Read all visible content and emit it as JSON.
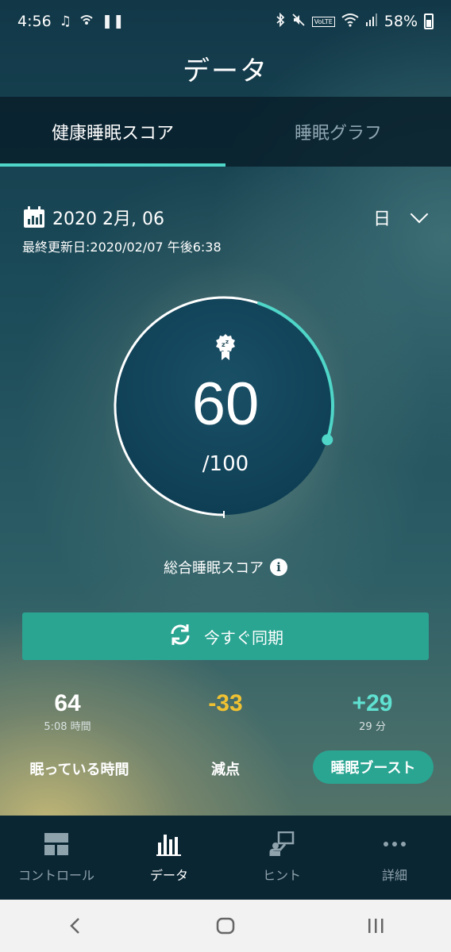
{
  "status_bar": {
    "time": "4:56",
    "battery": "58%",
    "left_icons": [
      "music-icon",
      "wifi-call-icon",
      "pause-icon"
    ],
    "right_icons": [
      "bluetooth-icon",
      "mute-icon",
      "volte-icon",
      "wifi-icon",
      "signal-icon",
      "battery-icon"
    ],
    "battery_level": 0.58
  },
  "header": {
    "title": "データ"
  },
  "tabs": [
    {
      "label": "健康睡眠スコア",
      "active": true
    },
    {
      "label": "睡眠グラフ",
      "active": false
    }
  ],
  "date_bar": {
    "date": "2020 2月, 06",
    "period": "日",
    "last_updated": "最終更新日:2020/02/07 午後6:38"
  },
  "score": {
    "value": "60",
    "max": "/100",
    "label": "総合睡眠スコア",
    "fraction": 0.6
  },
  "sync_button": {
    "label": "今すぐ同期"
  },
  "stats": [
    {
      "value": "64",
      "sub": "5:08 時間",
      "label": "眠っている時間",
      "color": "#ffffff"
    },
    {
      "value": "-33",
      "sub": "",
      "label": "減点",
      "color": "#f0c232"
    },
    {
      "value": "+29",
      "sub": "29 分",
      "label": "睡眠ブースト",
      "color": "#5fe0d0"
    }
  ],
  "bottom_nav": [
    {
      "label": "コントロール",
      "icon": "control-grid-icon",
      "active": false
    },
    {
      "label": "データ",
      "icon": "bar-chart-icon",
      "active": true
    },
    {
      "label": "ヒント",
      "icon": "hint-icon",
      "active": false
    },
    {
      "label": "詳細",
      "icon": "more-dots-icon",
      "active": false
    }
  ],
  "colors": {
    "accent": "#4fd6c8",
    "button": "#2aa592",
    "penalty": "#f0c232"
  }
}
